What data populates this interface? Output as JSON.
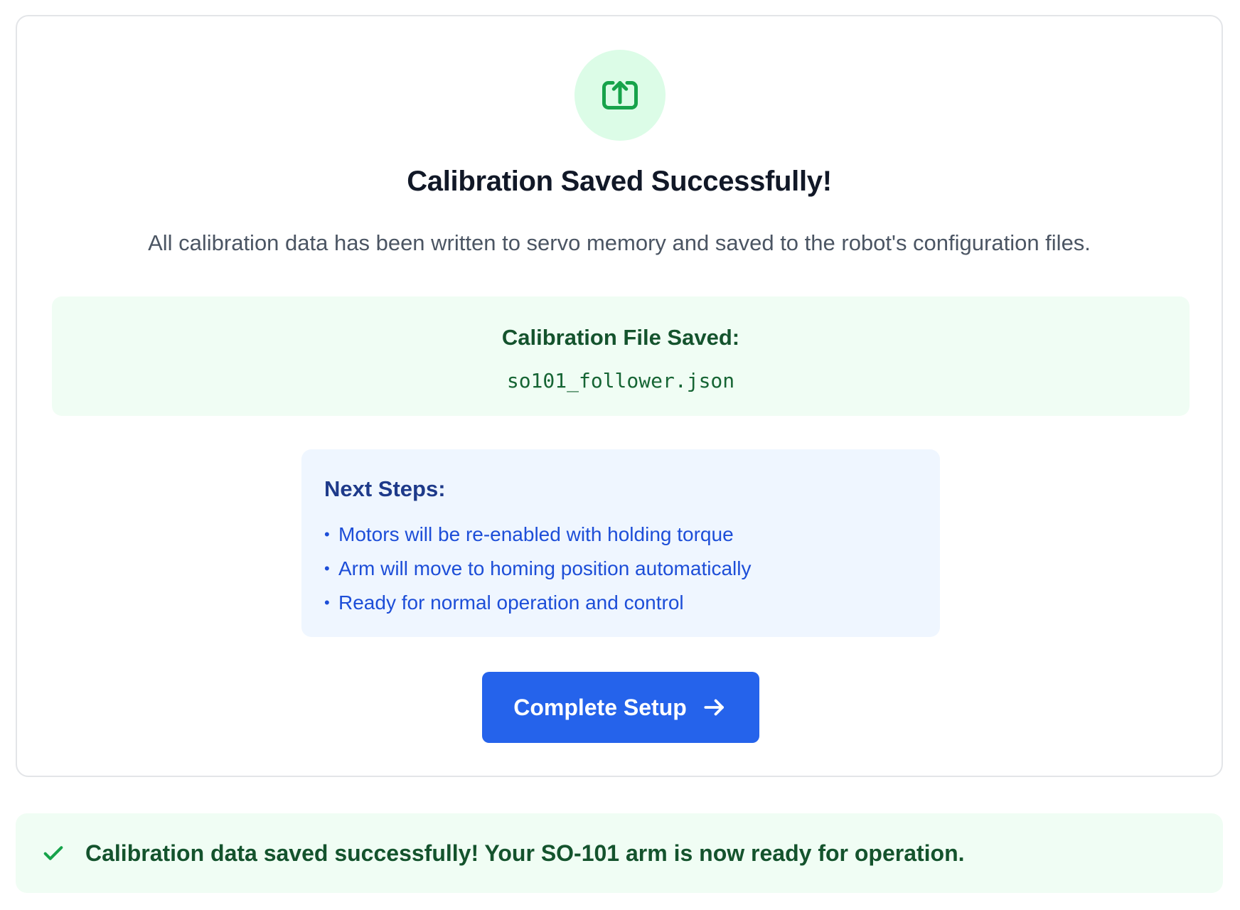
{
  "header": {
    "icon": "upload-icon",
    "title": "Calibration Saved Successfully!",
    "subtitle": "All calibration data has been written to servo memory and saved to the robot's configuration files."
  },
  "file_panel": {
    "label": "Calibration File Saved:",
    "filename": "so101_follower.json"
  },
  "next_steps": {
    "title": "Next Steps:",
    "bullet": "•",
    "items": [
      "Motors will be re-enabled with holding torque",
      "Arm will move to homing position automatically",
      "Ready for normal operation and control"
    ]
  },
  "actions": {
    "complete_label": "Complete Setup",
    "complete_icon": "arrow-right-icon"
  },
  "toast": {
    "icon": "check-icon",
    "message": "Calibration data saved successfully! Your SO-101 arm is now ready for operation."
  },
  "colors": {
    "success_green": "#16a34a",
    "success_bg": "#dcfce7",
    "file_bg": "#f0fdf4",
    "steps_bg": "#eff6ff",
    "primary_blue": "#2563eb"
  }
}
